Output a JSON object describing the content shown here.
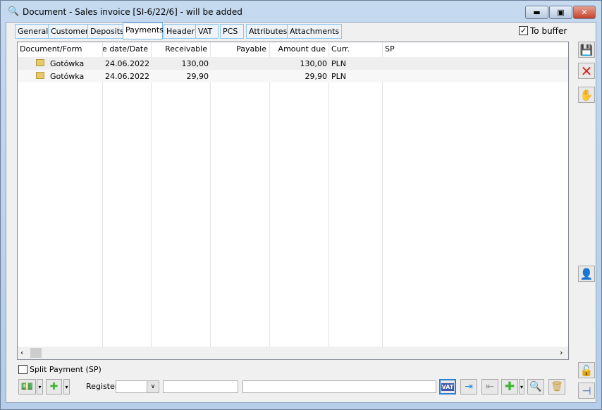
{
  "window": {
    "title": "Document - Sales invoice [SI-6/22/6]  - will be added",
    "minimize": "minimize",
    "maximize": "maximize",
    "close": "close"
  },
  "tabs": [
    {
      "label": "General"
    },
    {
      "label": "Customer"
    },
    {
      "label": "Deposits"
    },
    {
      "label": "Payments",
      "active": true
    },
    {
      "label": "Header"
    },
    {
      "label": "VAT"
    },
    {
      "label": "PCS"
    },
    {
      "label": "Attributes"
    },
    {
      "label": "Attachments"
    }
  ],
  "to_buffer": {
    "label": "To buffer",
    "checked": true
  },
  "table": {
    "columns": [
      "Document/Form",
      "ue date/Date",
      "Receivable",
      "Payable",
      "Amount due",
      "Curr.",
      "SP"
    ],
    "rows": [
      {
        "form": "Gotówka",
        "date": "24.06.2022",
        "receivable": "130,00",
        "payable": "",
        "amount_due": "130,00",
        "currency": "PLN",
        "sp": ""
      },
      {
        "form": "Gotówka",
        "date": "24.06.2022",
        "receivable": "29,90",
        "payable": "",
        "amount_due": "29,90",
        "currency": "PLN",
        "sp": ""
      }
    ]
  },
  "split_payment": {
    "label": "Split Payment (SP)",
    "checked": false
  },
  "register": {
    "label": "Register",
    "value": "",
    "field1": "",
    "field2": ""
  },
  "vat_button": "VAT"
}
